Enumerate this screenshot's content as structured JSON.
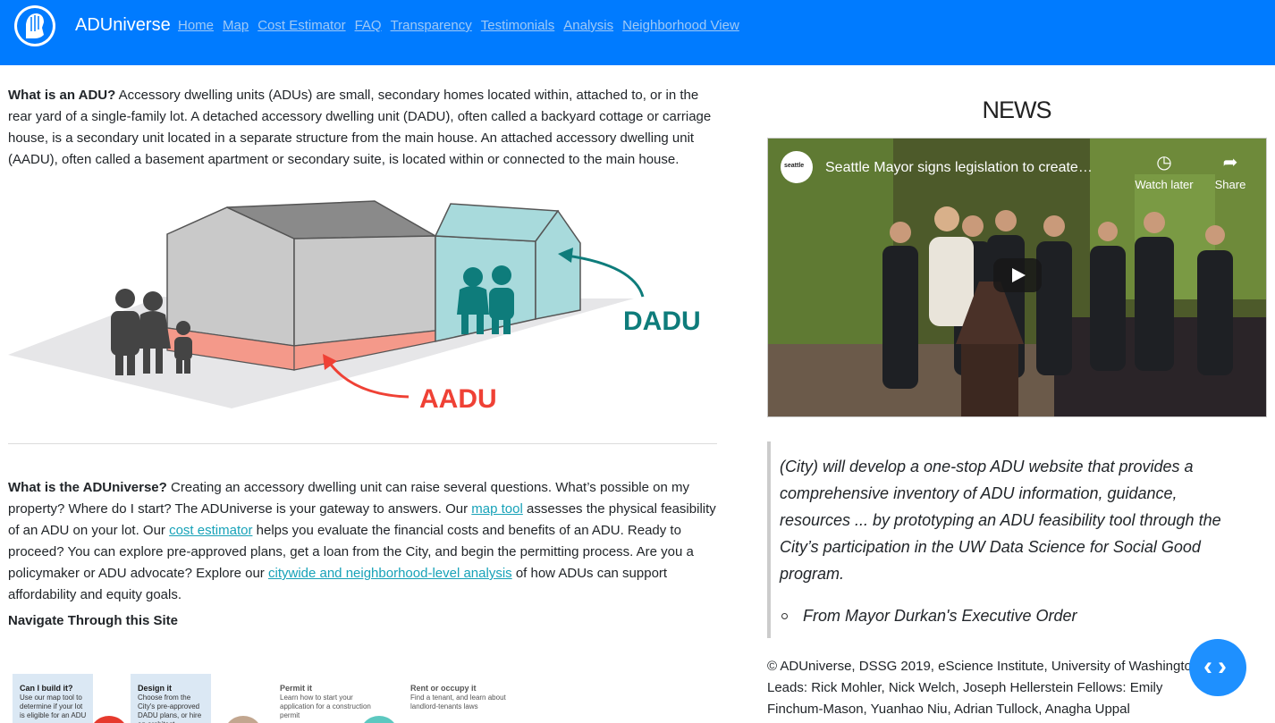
{
  "nav": {
    "brand": "ADUniverse",
    "links": [
      "Home",
      "Map",
      "Cost Estimator",
      "FAQ",
      "Transparency",
      "Testimonials",
      "Analysis",
      "Neighborhood View"
    ]
  },
  "intro": {
    "q1_bold": "What is an ADU?",
    "q1_text": " Accessory dwelling units (ADUs) are small, secondary homes located within, attached to, or in the rear yard of a single-family lot. A detached accessory dwelling unit (DADU), often called a backyard cottage or carriage house, is a secondary unit located in a separate structure from the main house. An attached accessory dwelling unit (AADU), often called a basement apartment or secondary suite, is located within or connected to the main house."
  },
  "illustration": {
    "dadu_label": "DADU",
    "aadu_label": "AADU",
    "colors": {
      "dadu": "#0e7c7b",
      "aadu": "#ef4135",
      "house": "#c9c9c9",
      "cottage": "#a8dadc",
      "basement": "#f4998a"
    }
  },
  "universe": {
    "q2_bold": "What is the ADUniverse?",
    "t1": " Creating an accessory dwelling unit can raise several questions. What’s possible on my property? Where do I start? The ADUniverse is your gateway to answers. Our ",
    "link1": "map tool",
    "t2": " assesses the physical feasibility of an ADU on your lot. Our ",
    "link2": "cost estimator",
    "t3": " helps you evaluate the financial costs and benefits of an ADU. Ready to proceed? You can explore pre-approved plans, get a loan from the City, and begin the permitting process. Are you a policymaker or ADU advocate? Explore our ",
    "link3": "citywide and neighborhood-level analysis",
    "t4": " of how ADUs can support affordability and equity goals."
  },
  "navigate_heading": "Navigate Through this Site",
  "steps": [
    {
      "title": "Can I build it?",
      "text": "Use our map tool to determine if your lot is eligible for an ADU"
    },
    {
      "title": "Design it",
      "text": "Choose from the City's pre-approved DADU plans, or hire an architect"
    },
    {
      "title": "Permit it",
      "text": "Learn how to start your application for a construction permit"
    },
    {
      "title": "Rent or occupy it",
      "text": "Find a tenant, and learn about landlord-tenants laws"
    }
  ],
  "news": {
    "heading": "NEWS",
    "video": {
      "channel": "seattle",
      "title": "Seattle Mayor signs legislation to create…",
      "watch_later": "Watch later",
      "share": "Share"
    },
    "quote": "(City) will develop a one-stop ADU website that provides a comprehensive inventory of ADU information, guidance, resources ... by prototyping an ADU feasibility tool through the City’s participation in the UW Data Science for Social Good program.",
    "quote_source": "From Mayor Durkan's Executive Order"
  },
  "footer": "© ADUniverse, DSSG 2019, eScience Institute, University of Washington Leads: Rick Mohler, Nick Welch, Joseph Hellerstein Fellows: Emily Finchum-Mason, Yuanhao Niu, Adrian Tullock, Anagha Uppal",
  "code_button": "‹›"
}
